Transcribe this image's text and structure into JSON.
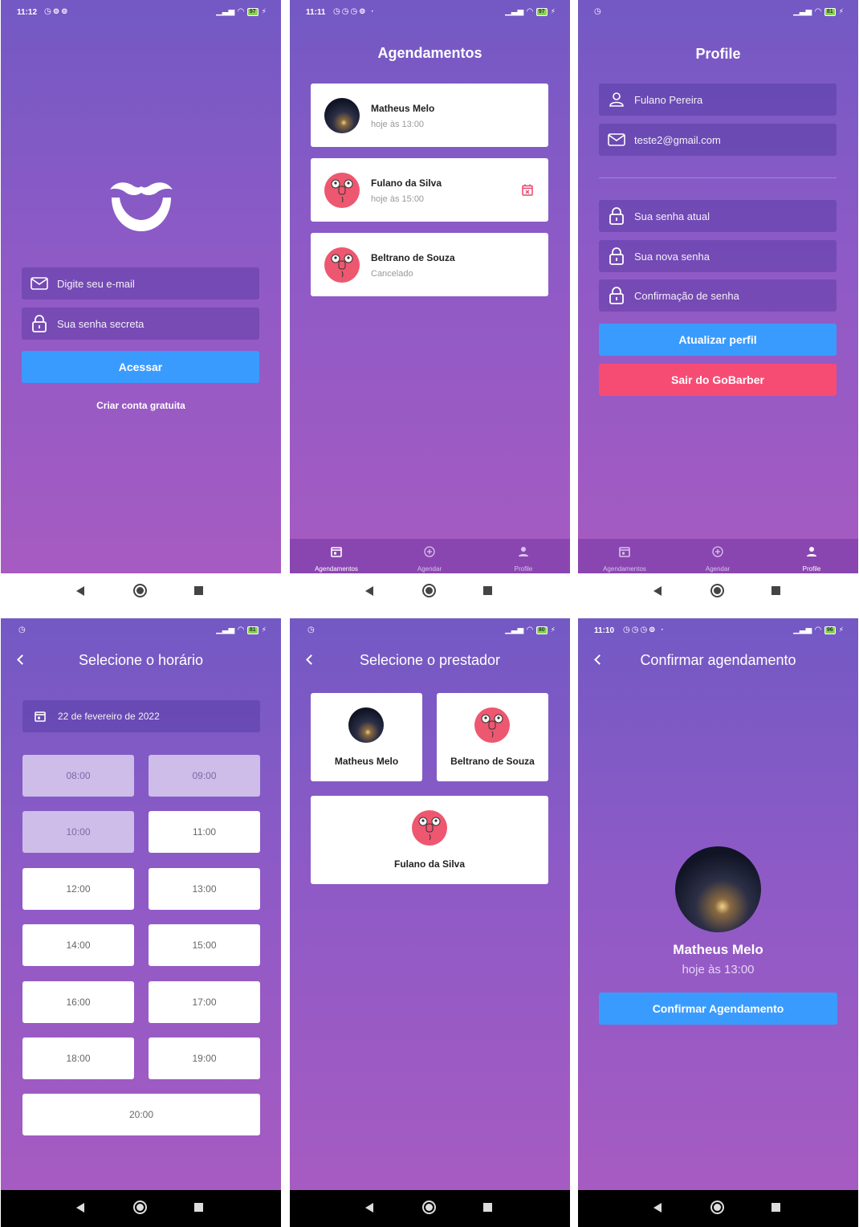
{
  "status": {
    "s1_time": "11:12",
    "s2_time": "11:11",
    "s6_time": "11:10",
    "battery_s1": "97",
    "battery_s2": "97",
    "battery_s3": "81",
    "battery_s4": "81",
    "battery_s5": "80",
    "battery_s6": "96"
  },
  "login": {
    "email_placeholder": "Digite seu e-mail",
    "password_placeholder": "Sua senha secreta",
    "submit_label": "Acessar",
    "create_account": "Criar conta gratuita"
  },
  "appointments": {
    "title": "Agendamentos",
    "items": [
      {
        "name": "Matheus Melo",
        "info": "hoje às 13:00"
      },
      {
        "name": "Fulano da Silva",
        "info": "hoje às 15:00"
      },
      {
        "name": "Beltrano de Souza",
        "info": "Cancelado"
      }
    ]
  },
  "tabs": {
    "appointments": "Agendamentos",
    "schedule": "Agendar",
    "profile": "Profile"
  },
  "profile": {
    "title": "Profile",
    "name_value": "Fulano Pereira",
    "email_value": "teste2@gmail.com",
    "current_password": "Sua senha atual",
    "new_password": "Sua nova senha",
    "confirm_password": "Confirmação de senha",
    "update_label": "Atualizar perfil",
    "logout_label": "Sair do GoBarber"
  },
  "time_select": {
    "title": "Selecione o horário",
    "date": "22 de fevereiro de 2022",
    "slots": [
      "08:00",
      "09:00",
      "10:00",
      "11:00",
      "12:00",
      "13:00",
      "14:00",
      "15:00",
      "16:00",
      "17:00",
      "18:00",
      "19:00",
      "20:00"
    ],
    "unavailable": [
      "08:00",
      "09:00",
      "10:00"
    ]
  },
  "provider_select": {
    "title": "Selecione o prestador",
    "providers": [
      "Matheus Melo",
      "Beltrano de Souza",
      "Fulano da Silva"
    ]
  },
  "confirm": {
    "title": "Confirmar agendamento",
    "name": "Matheus Melo",
    "when": "hoje às 13:00",
    "button": "Confirmar Agendamento"
  },
  "colors": {
    "primary_button": "#3a9bff",
    "danger_button": "#f64c74",
    "avatar_pink": "#ee5770",
    "cancel_icon": "#e8476b"
  }
}
